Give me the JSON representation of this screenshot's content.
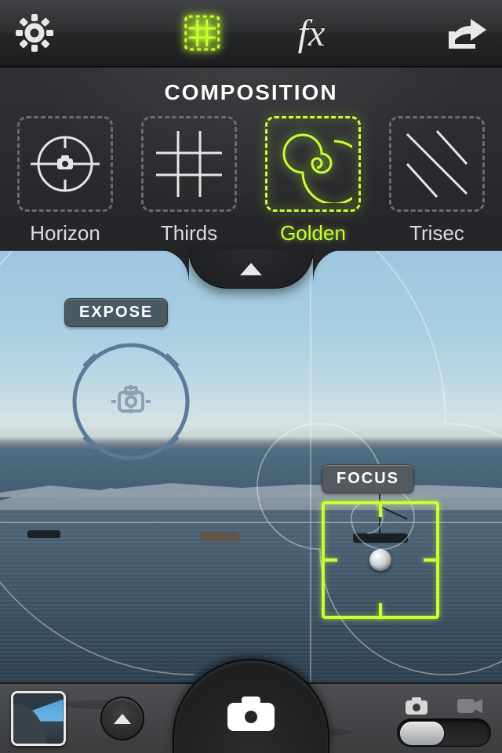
{
  "topbar": {
    "settings_icon": "gear",
    "composition_icon": "grid",
    "effects_label": "fx",
    "share_icon": "share"
  },
  "panel": {
    "title": "COMPOSITION",
    "items": [
      {
        "label": "Horizon",
        "icon": "horizon",
        "active": false
      },
      {
        "label": "Thirds",
        "icon": "thirds",
        "active": false
      },
      {
        "label": "Golden",
        "icon": "golden",
        "active": true
      },
      {
        "label": "Trisec",
        "icon": "trisec",
        "active": false
      }
    ],
    "collapse_icon": "chevron-up"
  },
  "viewfinder": {
    "expose_label": "EXPOSE",
    "focus_label": "FOCUS",
    "overlay": "golden-spiral"
  },
  "bottombar": {
    "thumbnail": "last-photo",
    "options_icon": "chevron-up",
    "shutter_icon": "camera",
    "mode": {
      "photo_icon": "camera-small",
      "video_icon": "video",
      "selected": "photo"
    }
  },
  "colors": {
    "accent": "#c6ff33"
  }
}
